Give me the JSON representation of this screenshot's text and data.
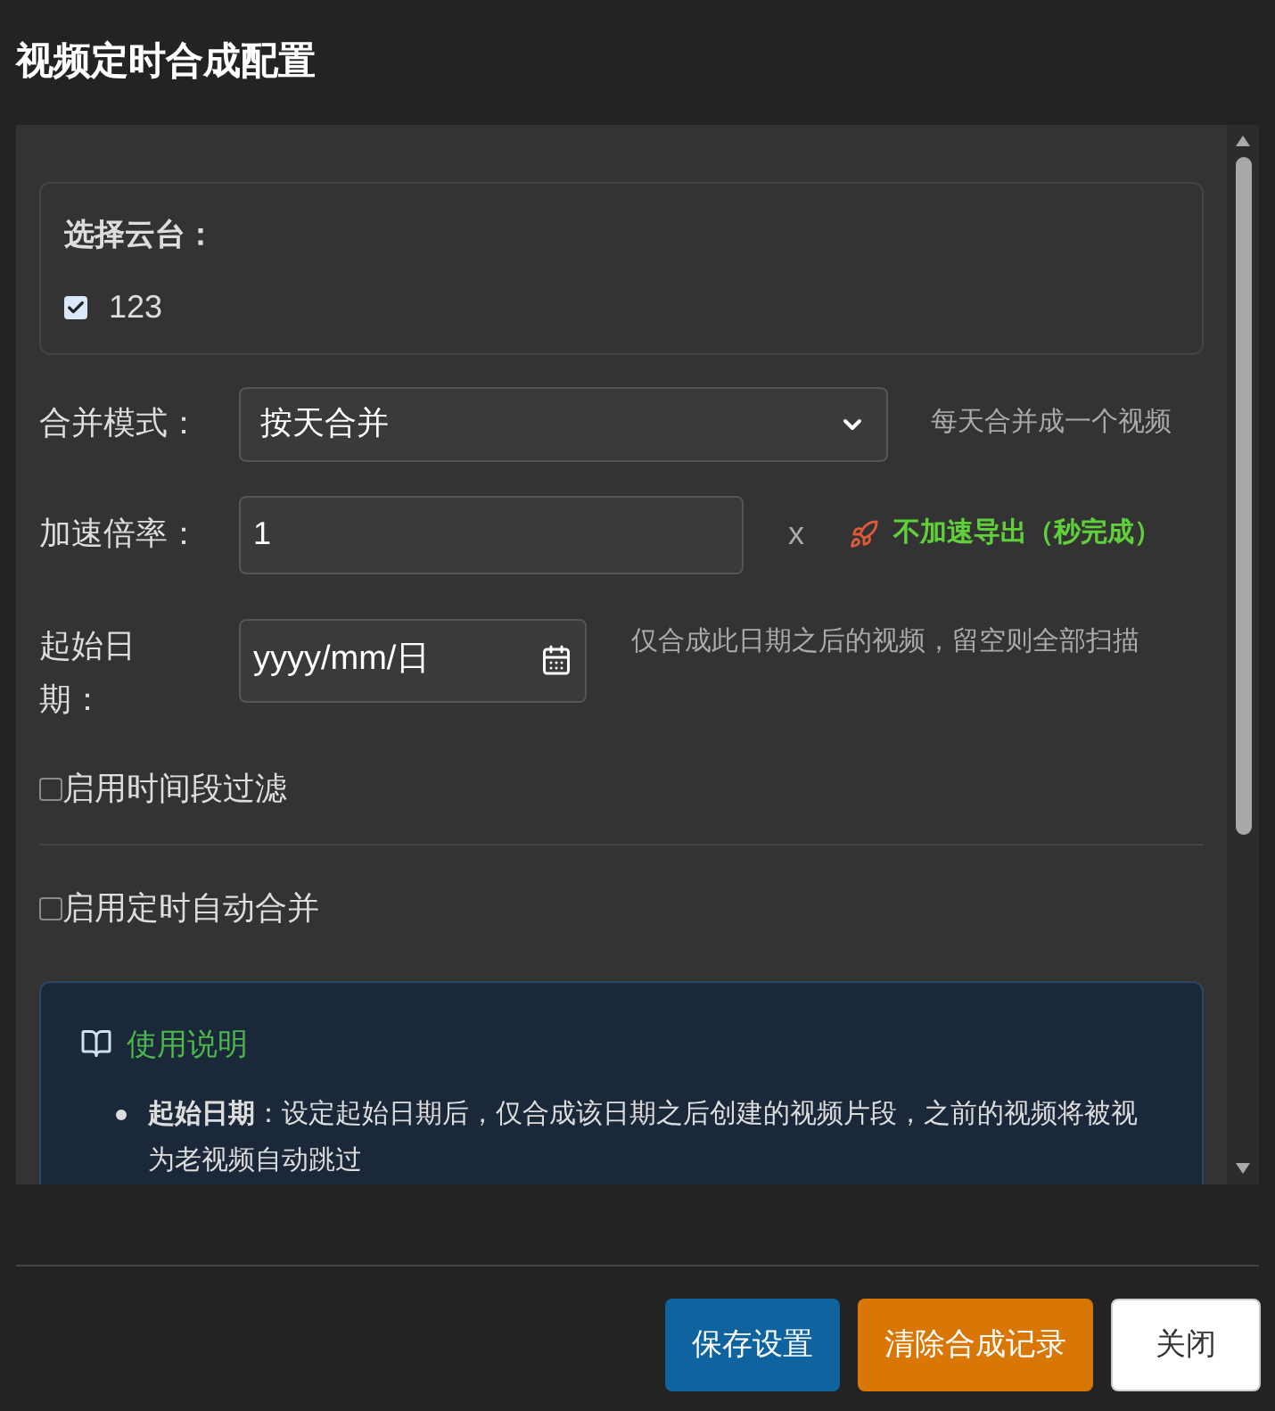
{
  "window": {
    "title": "视频定时合成配置"
  },
  "ptz": {
    "label": "选择云台：",
    "items": [
      {
        "label": "123",
        "checked": true
      }
    ]
  },
  "merge_mode": {
    "label": "合并模式：",
    "value": "按天合并",
    "hint": "每天合并成一个视频"
  },
  "speed": {
    "label": "加速倍率：",
    "value": "1",
    "unit": "x",
    "note": "不加速导出（秒完成）"
  },
  "start_date": {
    "label": "起始日期：",
    "placeholder": "yyyy/mm/日",
    "hint": "仅合成此日期之后的视频，留空则全部扫描"
  },
  "options": [
    {
      "label": "启用时间段过滤",
      "checked": false
    },
    {
      "label": "启用定时自动合并",
      "checked": false
    }
  ],
  "help": {
    "title": "使用说明",
    "items": [
      "**起始日期**：设定起始日期后，仅合成该日期之后创建的视频片段，之前的视频将被视为老视频自动跳过"
    ]
  },
  "buttons": [
    {
      "label": "保存设置",
      "kind": "primary"
    },
    {
      "label": "清除合成记录",
      "kind": "warning"
    },
    {
      "label": "关闭",
      "kind": "plain"
    }
  ]
}
